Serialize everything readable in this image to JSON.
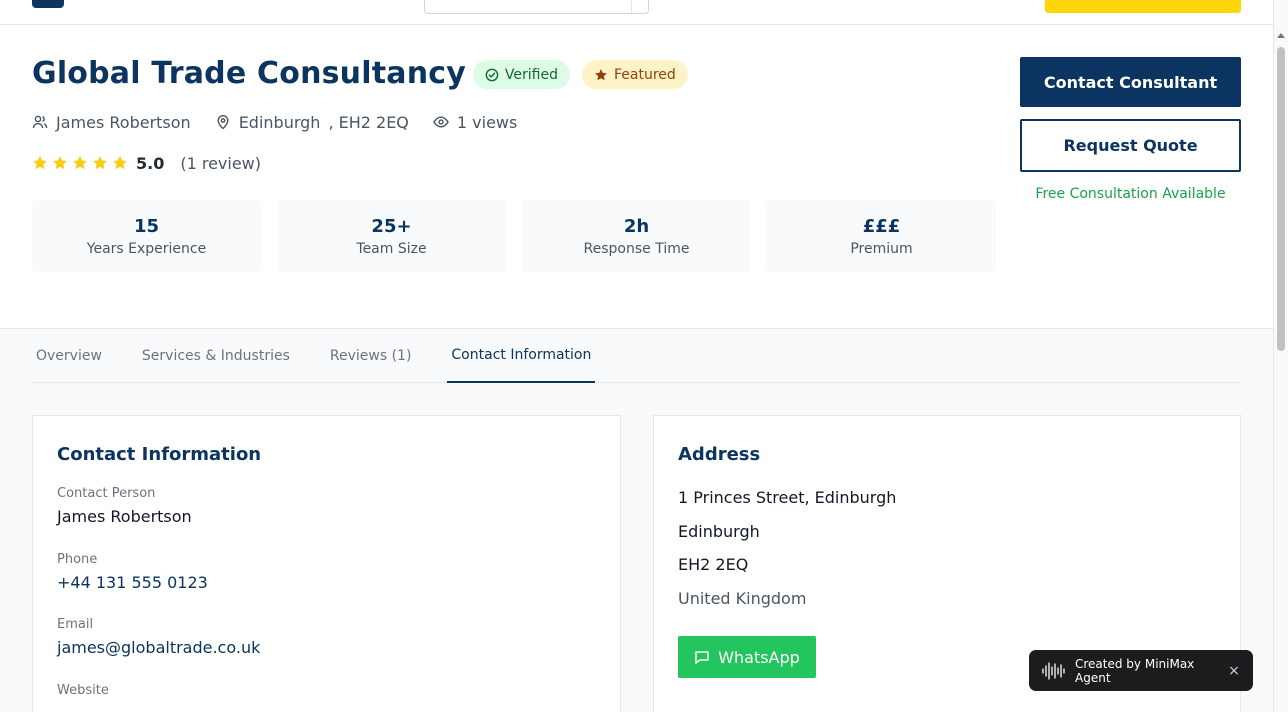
{
  "listing": {
    "title": "Global Trade Consultancy",
    "badges": {
      "verified": "Verified",
      "featured": "Featured"
    },
    "contact_person": "James Robertson",
    "location_city": "Edinburgh",
    "location_postcode": ", EH2 2EQ",
    "views": "1 views",
    "rating": {
      "value": "5.0",
      "count": "(1 review)",
      "stars": 5
    }
  },
  "stats": [
    {
      "value": "15",
      "label": "Years Experience"
    },
    {
      "value": "25+",
      "label": "Team Size"
    },
    {
      "value": "2h",
      "label": "Response Time"
    },
    {
      "value": "£££",
      "label": "Premium"
    }
  ],
  "actions": {
    "contact_consultant": "Contact Consultant",
    "request_quote": "Request Quote",
    "free_consultation": "Free Consultation Available"
  },
  "tabs": [
    {
      "label": "Overview",
      "active": false
    },
    {
      "label": "Services & Industries",
      "active": false
    },
    {
      "label": "Reviews (1)",
      "active": false
    },
    {
      "label": "Contact Information",
      "active": true
    }
  ],
  "contact_card": {
    "title": "Contact Information",
    "person_label": "Contact Person",
    "person_value": "James Robertson",
    "phone_label": "Phone",
    "phone_value": "+44 131 555 0123",
    "email_label": "Email",
    "email_value": "james@globaltrade.co.uk",
    "website_label": "Website"
  },
  "address_card": {
    "title": "Address",
    "line1": "1 Princes Street, Edinburgh",
    "city": "Edinburgh",
    "postcode": "EH2 2EQ",
    "country": "United Kingdom",
    "whatsapp": "WhatsApp"
  },
  "toast": {
    "text": "Created by MiniMax Agent",
    "close": "×"
  },
  "colors": {
    "brand_navy": "#0b3560",
    "accent_yellow": "#ffd60a",
    "success_green": "#16a34a",
    "whatsapp_green": "#22c55e",
    "star_yellow": "#facc15"
  }
}
